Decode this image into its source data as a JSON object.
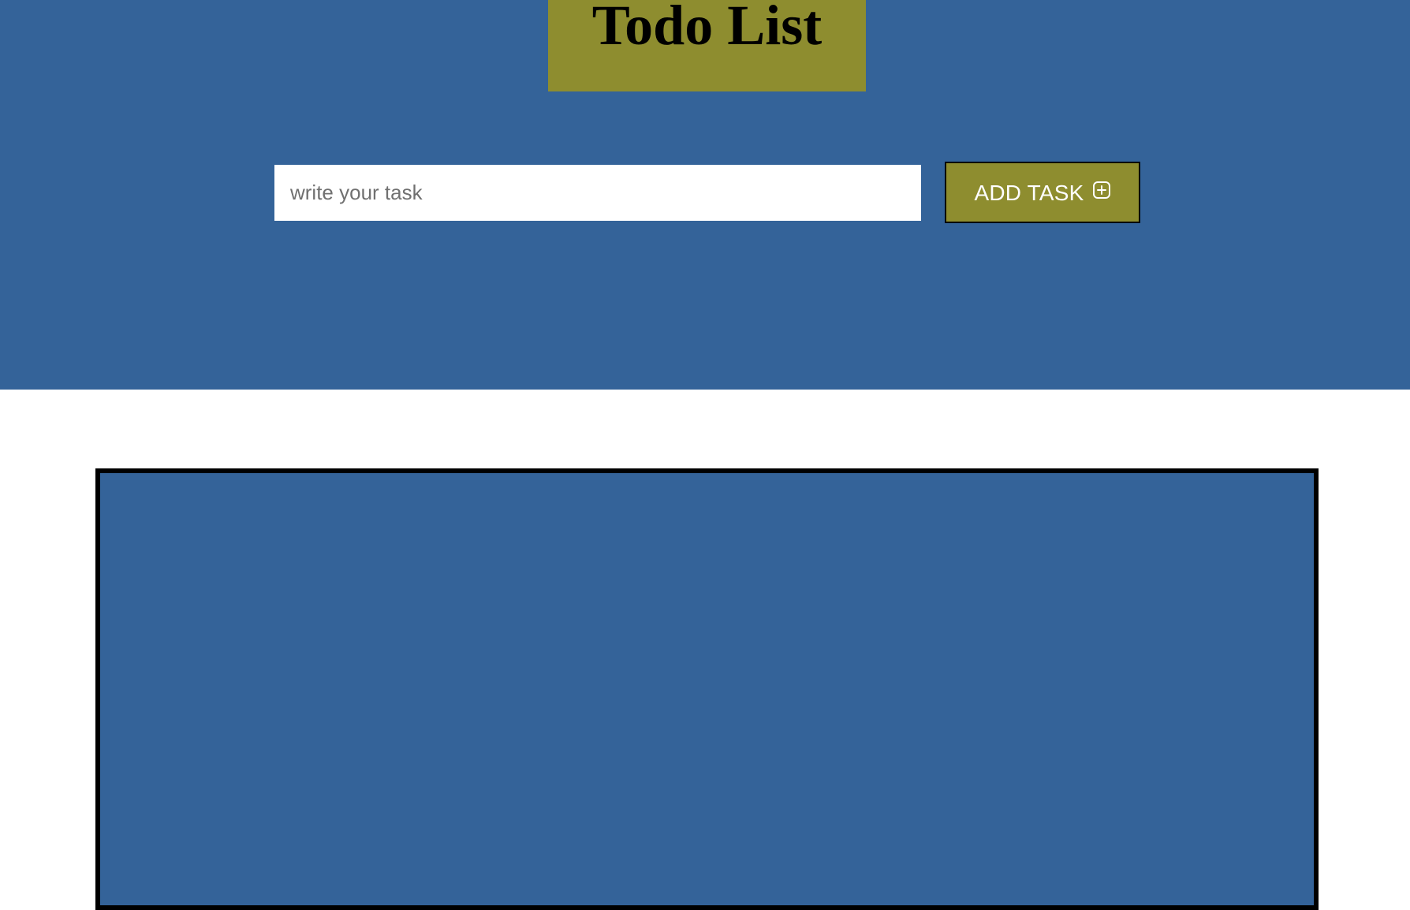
{
  "header": {
    "title": "Todo List"
  },
  "task_form": {
    "input_placeholder": "write your task",
    "input_value": "",
    "add_button_label": "ADD TASK"
  },
  "icons": {
    "add_button_icon": "plus-square-icon"
  },
  "task_list": {
    "items": []
  },
  "colors": {
    "background_blue": "#346399",
    "accent_olive": "#8e8d2f",
    "border": "#000000"
  }
}
